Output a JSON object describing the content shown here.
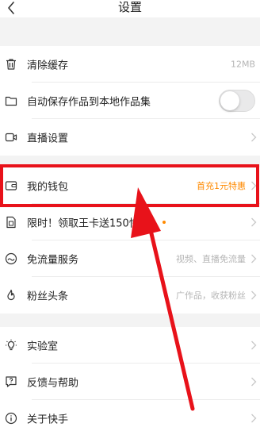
{
  "header": {
    "title": "设置",
    "back_icon": "chevron-left-icon"
  },
  "group1": [
    {
      "label": "清除缓存",
      "icon": "trash-icon",
      "value": "12MB"
    },
    {
      "label": "自动保存作品到本地作品集",
      "icon": "folder-icon",
      "toggle": false
    },
    {
      "label": "直播设置",
      "icon": "video-camera-icon"
    }
  ],
  "group2": [
    {
      "label": "我的钱包",
      "icon": "wallet-icon",
      "value": "首充1元特惠",
      "value_color": "#ff8a00"
    },
    {
      "label": "限时！领取王卡送150快币",
      "icon": "sim-card-icon",
      "badge": "new-dot"
    },
    {
      "label": "免流量服务",
      "icon": "signal-wave-icon",
      "value": "视频、直播免流量"
    },
    {
      "label": "粉丝头条",
      "icon": "flame-icon",
      "value": "广作品，收获粉丝"
    }
  ],
  "group3": [
    {
      "label": "实验室",
      "icon": "bulb-icon"
    },
    {
      "label": "反馈与帮助",
      "icon": "help-chat-icon"
    },
    {
      "label": "关于快手",
      "icon": "info-icon"
    }
  ],
  "annotation": {
    "highlight_color": "#e8121a",
    "arrow_color": "#e8121a"
  },
  "colors": {
    "accent": "#ff8a00",
    "background": "#f3f3f3",
    "text": "#222222",
    "muted": "#b5b5b5"
  }
}
